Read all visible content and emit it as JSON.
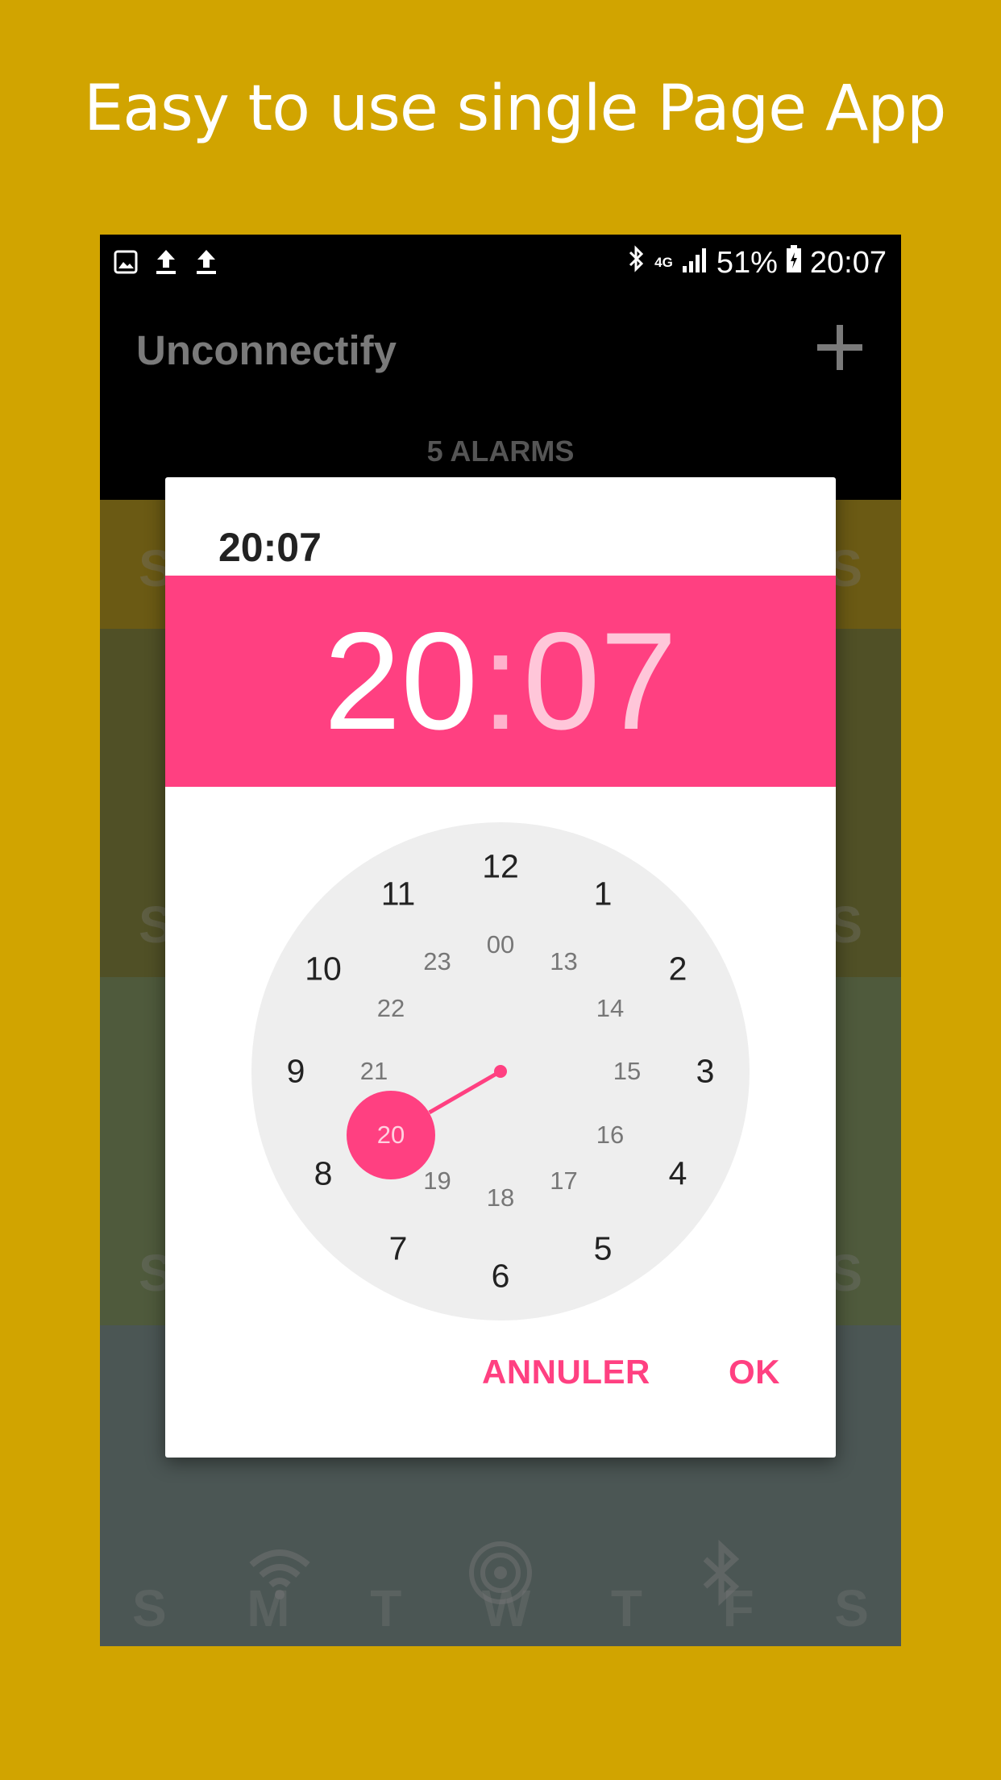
{
  "promo": {
    "headline": "Easy to use single Page App"
  },
  "status_bar": {
    "left_icons": [
      "image-icon",
      "upload-icon",
      "upload-icon"
    ],
    "network": "4G",
    "battery": "51%",
    "time": "20:07"
  },
  "app_bar": {
    "title": "Unconnectify",
    "add_icon": "plus-icon"
  },
  "alarms_tab": {
    "label": "5 ALARMS"
  },
  "alarm_rows": {
    "row_day_left": "S",
    "row_day_right": "S",
    "days": [
      "S",
      "M",
      "T",
      "W",
      "T",
      "F",
      "S"
    ],
    "icons": [
      "wifi-icon",
      "hotspot-icon",
      "bluetooth-icon"
    ],
    "colors": [
      "#6b5a14",
      "#505026",
      "#4f5a3c",
      "#4b5654"
    ]
  },
  "dialog": {
    "title": "20:07",
    "header": {
      "hour": "20",
      "separator": ":",
      "minute": "07"
    },
    "accent": "#ff4081",
    "clock": {
      "outer": [
        "12",
        "1",
        "2",
        "3",
        "4",
        "5",
        "6",
        "7",
        "8",
        "9",
        "10",
        "11"
      ],
      "inner": [
        "00",
        "13",
        "14",
        "15",
        "16",
        "17",
        "18",
        "19",
        "20",
        "21",
        "22",
        "23"
      ],
      "selected": "20"
    },
    "cancel_label": "ANNULER",
    "ok_label": "OK"
  }
}
